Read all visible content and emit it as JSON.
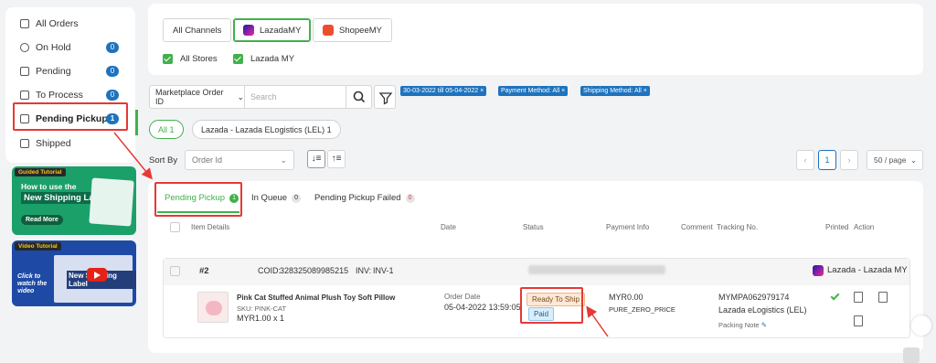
{
  "sidebar": {
    "items": [
      {
        "label": "All Orders",
        "icon": "list-icon"
      },
      {
        "label": "On Hold",
        "icon": "clock-icon",
        "count": "0"
      },
      {
        "label": "Pending",
        "icon": "layers-icon",
        "count": "0"
      },
      {
        "label": "To Process",
        "icon": "clipboard-icon",
        "count": "0"
      },
      {
        "label": "Pending Pickup",
        "icon": "box-icon",
        "count": "1",
        "active": true
      },
      {
        "label": "Shipped",
        "icon": "truck-icon"
      }
    ]
  },
  "promos": {
    "shipping": {
      "tag": "Guided Tutorial",
      "line1": "How to use the",
      "line2": "New Shipping Label?",
      "button": "Read More"
    },
    "video": {
      "tag": "Video Tutorial",
      "caption": "Click to watch the video",
      "title": "New Shipping Label"
    }
  },
  "channels": {
    "tabs": [
      "All Channels",
      "LazadaMY",
      "ShopeeMY"
    ],
    "selected": "LazadaMY",
    "stores": [
      "All Stores",
      "Lazada MY"
    ]
  },
  "search": {
    "field": "Marketplace Order ID",
    "placeholder": "Search"
  },
  "filters": [
    "30-03-2022 till 05-04-2022",
    "Payment Method: All",
    "Shipping Method: All"
  ],
  "pills": [
    "All 1",
    "Lazada - Lazada ELogistics (LEL) 1"
  ],
  "sort": {
    "label": "Sort By",
    "placeholder": "Order Id"
  },
  "pagination": {
    "current": "1",
    "per_page": "50 / page"
  },
  "tabs": [
    {
      "label": "Pending Pickup",
      "count": "1"
    },
    {
      "label": "In Queue",
      "count": "0"
    },
    {
      "label": "Pending Pickup Failed",
      "count": "0"
    }
  ],
  "table": {
    "headers": [
      "Item Details",
      "Date",
      "Status",
      "Payment Info",
      "Comment",
      "Tracking No.",
      "Printed",
      "Action"
    ]
  },
  "order": {
    "number": "#2",
    "coid_label": "COID:",
    "coid": "328325089985215",
    "inv_label": "INV:",
    "inv": "INV-1",
    "channel": "Lazada - Lazada MY",
    "item_name": "Pink Cat Stuffed Animal Plush Toy Soft Pillow",
    "sku": "SKU: PINK-CAT",
    "price_qty": "MYR1.00 x 1",
    "date_label": "Order Date",
    "date": "05-04-2022 13:59:05",
    "status": [
      "Ready To Ship",
      "Paid"
    ],
    "amount": "MYR0.00",
    "price_type": "PURE_ZERO_PRICE",
    "tracking": "MYMPA062979174",
    "logistics": "Lazada eLogistics (LEL)",
    "packing_note": "Packing Note"
  },
  "colors": {
    "accent": "#40b14b",
    "primary": "#1e73be",
    "highlight": "#e53935"
  }
}
